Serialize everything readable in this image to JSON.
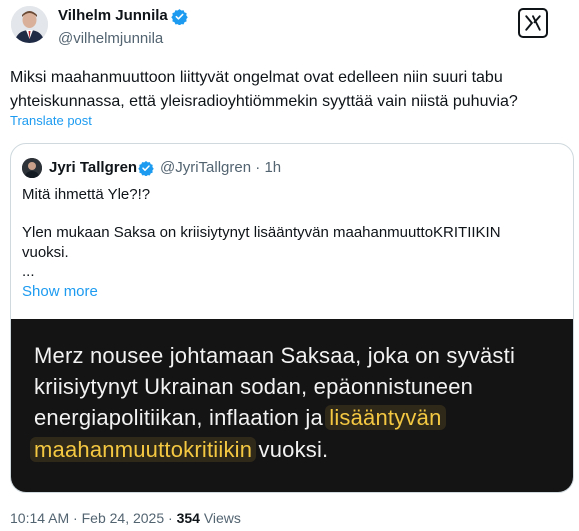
{
  "author": {
    "name": "Vilhelm Junnila",
    "handle": "@vilhelmjunnila",
    "verified": true
  },
  "tweet": {
    "text_line_1": "Miksi maahanmuuttoon liittyvät ongelmat ovat edelleen niin suuri tabu",
    "text_line_2": "yhteiskunnassa, että yleisradioyhtiömmekin syyttää vain niistä puhuvia?",
    "translate_label": "Translate post"
  },
  "quoted_tweet": {
    "name": "Jyri Tallgren",
    "handle": "@JyriTallgren",
    "separator": "·",
    "time": "1h",
    "line_1": "Mitä ihmettä Yle?!?",
    "line_2": "Ylen mukaan Saksa on kriisiytynyt lisääntyvän maahanmuuttoKRITIIKIN",
    "line_3": "vuoksi.",
    "line_4": "...",
    "show_more_label": "Show more",
    "image_caption": {
      "line_1": "Merz nousee johtamaan Saksaa, joka on syvästi",
      "line_2": "kriisiytynyt Ukrainan sodan, epäonnistuneen",
      "line_3_plain": "energiapolitiikan, inflaation ja ",
      "line_3_highlight": "lisääntyvän",
      "line_4_highlight": "maahanmuuttokritiikin",
      "line_4_plain": " vuoksi."
    }
  },
  "footer": {
    "time": "10:14 AM",
    "dot_1": "·",
    "date": "Feb 24, 2025",
    "dot_2": "·",
    "views_count": "354",
    "views_label": "Views"
  },
  "colors": {
    "accent": "#1d9bf0",
    "highlight": "#f5c842",
    "secondary_text": "#536471"
  }
}
